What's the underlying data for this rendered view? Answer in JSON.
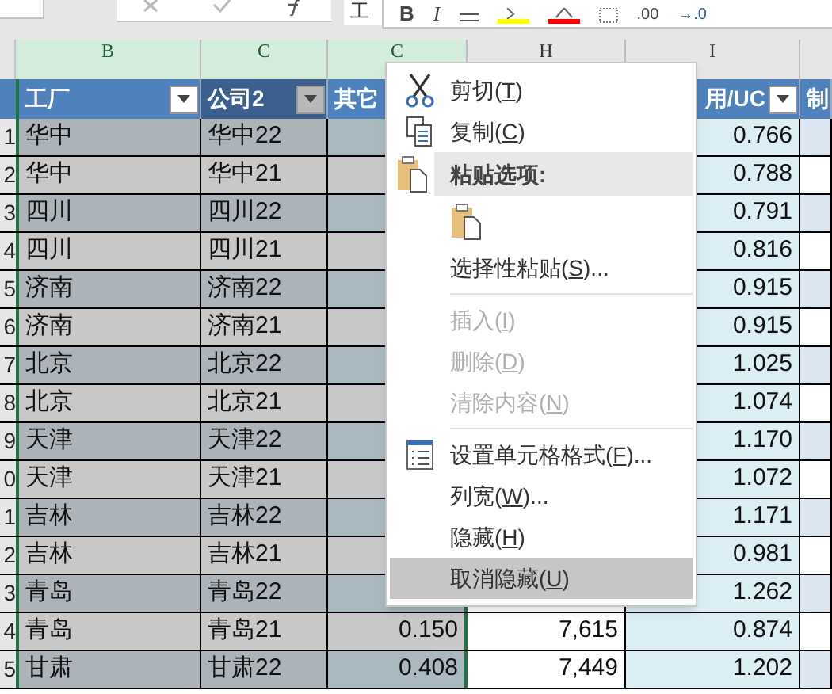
{
  "formula_bar": {
    "value": "工"
  },
  "mini_toolbar": {
    "bold": "B",
    "italic": "I",
    "decimals_more": ".00",
    "decimals_less": "→.0"
  },
  "column_headers": [
    "B",
    "C",
    "C",
    "H",
    "I"
  ],
  "table": {
    "columns": [
      {
        "label": "工厂",
        "filter": true,
        "sorted": false
      },
      {
        "label": "公司2",
        "filter": true,
        "sorted": true
      },
      {
        "label": "其它",
        "sorted": false
      },
      {},
      {
        "label": "用/UC",
        "filter": true,
        "sorted": false
      },
      {
        "label": "制",
        "sorted": false
      }
    ],
    "rows": [
      {
        "num": "1",
        "cells": [
          "华中",
          "华中22",
          "",
          "",
          "0.766"
        ]
      },
      {
        "num": "2",
        "cells": [
          "华中",
          "华中21",
          "",
          "",
          "0.788"
        ]
      },
      {
        "num": "3",
        "cells": [
          "四川",
          "四川22",
          "",
          "",
          "0.791"
        ]
      },
      {
        "num": "4",
        "cells": [
          "四川",
          "四川21",
          "",
          "",
          "0.816"
        ]
      },
      {
        "num": "5",
        "cells": [
          "济南",
          "济南22",
          "",
          "",
          "0.915"
        ]
      },
      {
        "num": "6",
        "cells": [
          "济南",
          "济南21",
          "",
          "",
          "0.915"
        ]
      },
      {
        "num": "7",
        "cells": [
          "北京",
          "北京22",
          "",
          "",
          "1.025"
        ]
      },
      {
        "num": "8",
        "cells": [
          "北京",
          "北京21",
          "",
          "",
          "1.074"
        ]
      },
      {
        "num": "9",
        "cells": [
          "天津",
          "天津22",
          "",
          "",
          "1.170"
        ]
      },
      {
        "num": "0",
        "cells": [
          "天津",
          "天津21",
          "",
          "",
          "1.072"
        ]
      },
      {
        "num": "1",
        "cells": [
          "吉林",
          "吉林22",
          "",
          "",
          "1.171"
        ]
      },
      {
        "num": "2",
        "cells": [
          "吉林",
          "吉林21",
          "",
          "",
          "0.981"
        ]
      },
      {
        "num": "3",
        "cells": [
          "青岛",
          "青岛22",
          "",
          "",
          "1.262"
        ]
      },
      {
        "num": "4",
        "cells": [
          "青岛",
          "青岛21",
          "0.150",
          "7,615",
          "0.874"
        ]
      },
      {
        "num": "5",
        "cells": [
          "甘肃",
          "甘肃22",
          "0.408",
          "7,449",
          "1.202"
        ]
      }
    ]
  },
  "context_menu": [
    {
      "kind": "item",
      "before": "剪切(",
      "accel": "T",
      "after": ")",
      "disabled": false,
      "selected": false
    },
    {
      "kind": "item",
      "before": "复制(",
      "accel": "C",
      "after": ")",
      "disabled": false,
      "selected": false
    },
    {
      "kind": "header",
      "before": "粘贴选项:"
    },
    {
      "kind": "paste-option"
    },
    {
      "kind": "item",
      "before": "选择性粘贴(",
      "accel": "S",
      "after": ")...",
      "disabled": false,
      "selected": false
    },
    {
      "kind": "separator"
    },
    {
      "kind": "item",
      "before": "插入(",
      "accel": "I",
      "after": ")",
      "disabled": true,
      "selected": false
    },
    {
      "kind": "item",
      "before": "删除(",
      "accel": "D",
      "after": ")",
      "disabled": true,
      "selected": false
    },
    {
      "kind": "item",
      "before": "清除内容(",
      "accel": "N",
      "after": ")",
      "disabled": true,
      "selected": false
    },
    {
      "kind": "separator"
    },
    {
      "kind": "item",
      "before": "设置单元格格式(",
      "accel": "F",
      "after": ")...",
      "disabled": false,
      "selected": false
    },
    {
      "kind": "item",
      "before": "列宽(",
      "accel": "W",
      "after": ")...",
      "disabled": false,
      "selected": false
    },
    {
      "kind": "item",
      "before": "隐藏(",
      "accel": "H",
      "after": ")",
      "disabled": false,
      "selected": false
    },
    {
      "kind": "item",
      "before": "取消隐藏(",
      "accel": "U",
      "after": ")",
      "disabled": false,
      "selected": true
    }
  ]
}
